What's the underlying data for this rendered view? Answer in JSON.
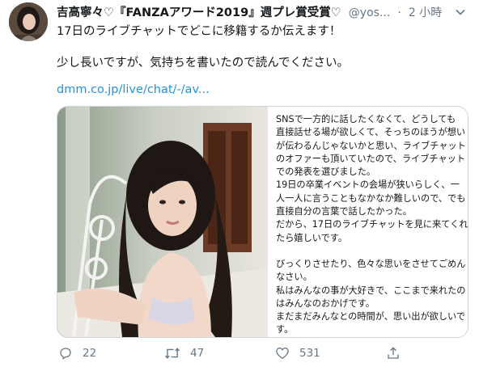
{
  "tweet": {
    "display_name": "吉高寧々♡『FANZAアワード2019』週プレ賞受賞♡",
    "handle": "@yos...",
    "separator": "·",
    "timestamp": "2 小時",
    "line1": "17日のライブチャットでどこに移籍するか伝えます！",
    "line2": "少し長いですが、気持ちを書いたので読んでください。",
    "link": "dmm.co.jp/live/chat/-/av..."
  },
  "card": {
    "lines": [
      "SNSで一方的に話したくなくて、どうしても",
      "直接話せる場が欲しくて、そっちのほうが想い",
      "が伝わるんじゃないかと思い、ライブチャット",
      "のオファーも頂いていたので、ライブチャット",
      "での発表を選びました。",
      "19日の卒業イベントの会場が狭いらしく、一",
      "人一人に言うこともなかなか難しいので、でも",
      "直接自分の言葉で話したかった。",
      "だから、17日のライブチャットを見に来てくれ",
      "たら嬉しいです。",
      "",
      "びっくりさせたり、色々な思いをさせてごめん",
      "なさい。",
      "私はみんなの事が大好きで、ここまで来れたの",
      "はみんなのおかげです。",
      "まだまだみんなとの時間が、思い出が欲しいで",
      "す。"
    ]
  },
  "actions": {
    "reply_count": "22",
    "retweet_count": "47",
    "like_count": "531"
  },
  "colors": {
    "link": "#1b95e0",
    "secondary": "#657786",
    "border": "#ccd6dd"
  },
  "icons": [
    "chevron-down-icon",
    "reply-icon",
    "retweet-icon",
    "like-icon",
    "share-icon"
  ]
}
